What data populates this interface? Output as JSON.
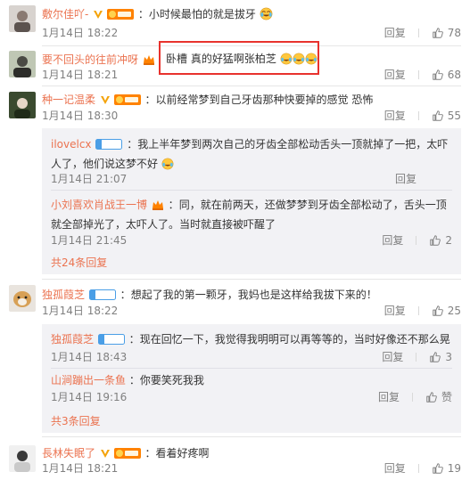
{
  "comments": [
    {
      "user": "敷尔佳吖-",
      "badges": [
        "verified-v-icon",
        "fan-level-badge"
      ],
      "text": "小时候最怕的就是拔牙",
      "emoji_count": 1,
      "time": "1月14日 18:22",
      "reply_label": "回复",
      "likes": "78"
    },
    {
      "user": "要不回头的往前冲呀",
      "badges": [
        "crown-badge"
      ],
      "text": "卧槽 真的好猛啊张柏芝",
      "emoji_count": 3,
      "time": "1月14日 18:21",
      "reply_label": "回复",
      "likes": "68"
    },
    {
      "user": "种一记温柔",
      "badges": [
        "verified-v-icon",
        "fan-level-badge"
      ],
      "text": "以前经常梦到自己牙齿那种快要掉的感觉 恐怖",
      "time": "1月14日 18:30",
      "reply_label": "回复",
      "likes": "55",
      "replies": [
        {
          "user": "ilovelcx",
          "badge_label": "铁粉",
          "text": "我上半年梦到两次自己的牙齿全部松动舌头一顶就掉了一把，太吓人了，他们说这梦不好",
          "time": "1月14日 21:07",
          "reply_label": "回复"
        },
        {
          "user": "小刘喜欢肖战王一博",
          "badges": [
            "crown-badge"
          ],
          "text": "同，就在前两天，还做梦梦到牙齿全部松动了，舌头一顶就全部掉光了，太吓人了。当时就直接被吓醒了",
          "time": "1月14日 21:45",
          "reply_label": "回复",
          "likes": "2"
        }
      ],
      "total": "共24条回复"
    },
    {
      "user": "独孤葭芝",
      "badge_label": "铁粉",
      "text": "想起了我的第一颗牙，我妈也是这样给我拔下来的！",
      "time": "1月14日 18:22",
      "reply_label": "回复",
      "likes": "25",
      "replies": [
        {
          "user": "独孤葭芝",
          "badge_label": "铁粉",
          "text": "现在回忆一下，我觉得我明明可以再等等的，当时好像还不那么晃",
          "time": "1月14日 18:43",
          "reply_label": "回复",
          "likes": "3"
        },
        {
          "user": "山涧蹦出一条鱼",
          "text": "你要笑死我我",
          "time": "1月14日 19:16",
          "reply_label": "回复",
          "like_label": "赞"
        }
      ],
      "total": "共3条回复"
    },
    {
      "user": "長林失眠了",
      "badges": [
        "verified-v-icon",
        "fan-level-badge"
      ],
      "text": "看着好疼啊",
      "time": "1月14日 18:21",
      "reply_label": "回复",
      "likes": "19"
    }
  ],
  "colors": {
    "username": "#eb7350",
    "text": "#333333",
    "meta": "#808080",
    "reply_bg": "#f2f2f5",
    "highlight": "#e8322d"
  }
}
